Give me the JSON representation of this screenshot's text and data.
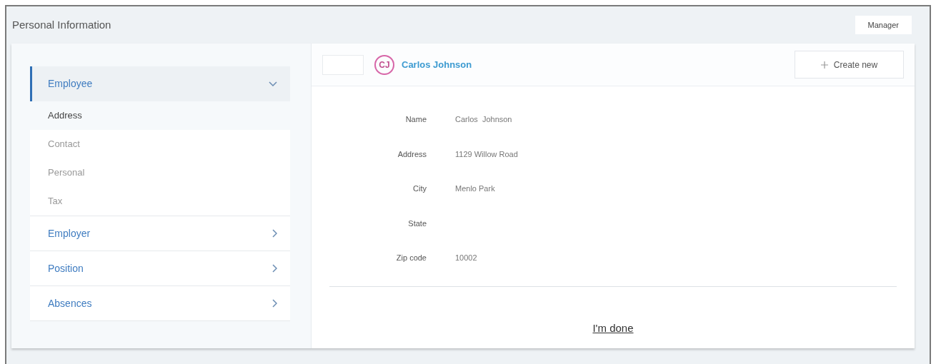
{
  "header": {
    "title": "Personal Information",
    "role_button": "Manager"
  },
  "nav": [
    {
      "label": "Employee",
      "expanded": true,
      "children": [
        {
          "label": "Address",
          "selected": true
        },
        {
          "label": "Contact",
          "selected": false
        },
        {
          "label": "Personal",
          "selected": false
        },
        {
          "label": "Tax",
          "selected": false
        }
      ]
    },
    {
      "label": "Employer",
      "expanded": false
    },
    {
      "label": "Position",
      "expanded": false
    },
    {
      "label": "Absences",
      "expanded": false
    }
  ],
  "record": {
    "initials": "CJ",
    "name": "Carlos Johnson",
    "create_button": "Create new"
  },
  "fields": [
    {
      "label": "Name",
      "value": "Carlos  Johnson"
    },
    {
      "label": "Address",
      "value": "1129 Willow Road"
    },
    {
      "label": "City",
      "value": "Menlo Park"
    },
    {
      "label": "State"
    },
    {
      "label": "Zip code",
      "value": "10002"
    }
  ],
  "done_link": "I'm done"
}
